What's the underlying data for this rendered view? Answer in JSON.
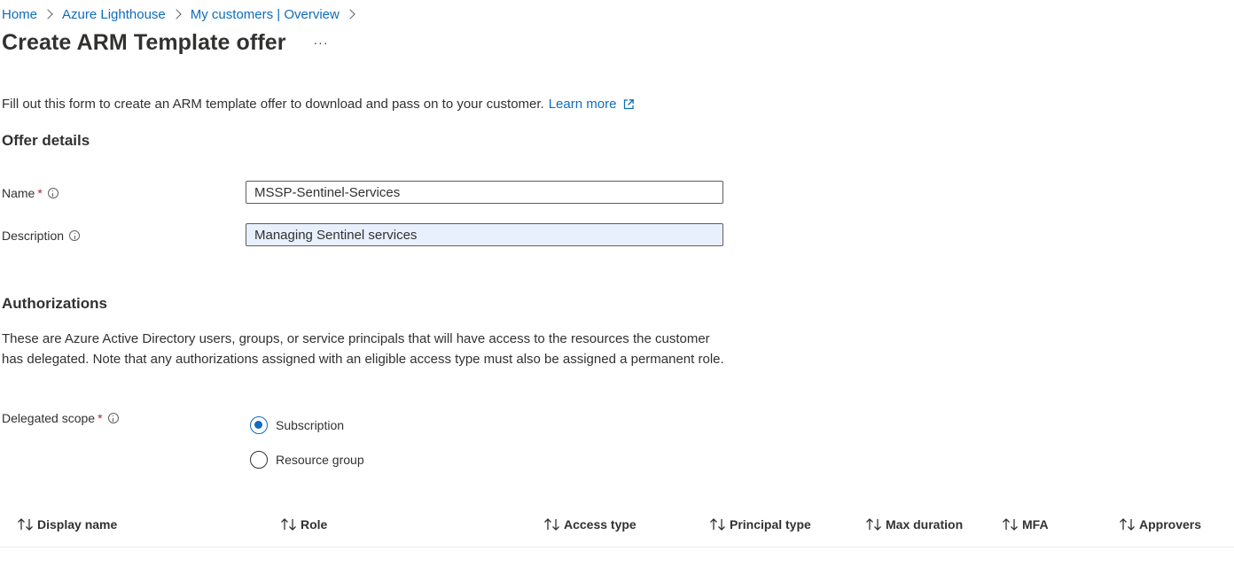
{
  "breadcrumb": [
    "Home",
    "Azure Lighthouse",
    "My customers | Overview"
  ],
  "page": {
    "title": "Create ARM Template offer",
    "more_label": "···"
  },
  "intro": {
    "text": "Fill out this form to create an ARM template offer to download and pass on to your customer.",
    "link": "Learn more"
  },
  "offer_details": {
    "heading": "Offer details",
    "name_label": "Name",
    "name_value": "MSSP-Sentinel-Services",
    "description_label": "Description",
    "description_value": "Managing Sentinel services",
    "required_mark": "*"
  },
  "authorizations": {
    "heading": "Authorizations",
    "description": "These are Azure Active Directory users, groups, or service principals that will have access to the resources the customer has delegated. Note that any authorizations assigned with an eligible access type must also be assigned a permanent role.",
    "scope_label": "Delegated scope",
    "scope_options": [
      "Subscription",
      "Resource group"
    ],
    "scope_selected": "Subscription"
  },
  "table": {
    "columns": [
      "Display name",
      "Role",
      "Access type",
      "Principal type",
      "Max duration",
      "MFA",
      "Approvers"
    ]
  },
  "colors": {
    "accent": "#0f6cbd",
    "required": "#a4262c",
    "autofill": "#e8f0fe"
  },
  "icons": [
    "chevron-right-icon",
    "external-link-icon",
    "info-icon",
    "sort-icon"
  ]
}
